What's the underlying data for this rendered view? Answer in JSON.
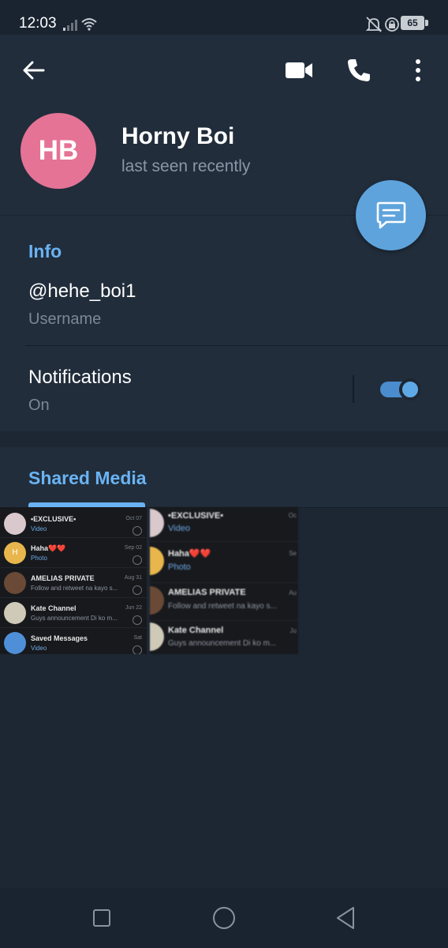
{
  "status_bar": {
    "time": "12:03",
    "battery": "65"
  },
  "header": {
    "avatar_initials": "HB",
    "name": "Horny Boi",
    "last_seen": "last seen recently",
    "icons": [
      "back-arrow-icon",
      "video-call-icon",
      "phone-icon",
      "more-vertical-icon"
    ],
    "fab_icon": "message-icon"
  },
  "info": {
    "title": "Info",
    "username": "@hehe_boi1",
    "username_label": "Username",
    "notifications_label": "Notifications",
    "notifications_value": "On",
    "notifications_enabled": true
  },
  "shared_media": {
    "title": "Shared Media",
    "thumb1": {
      "rows": [
        {
          "name": "•EXCLUSIVE•",
          "sub": "Video",
          "date": "Oct 07",
          "avatar_color": "#d9c8cc"
        },
        {
          "name": "Haha❤️❤️",
          "sub": "Photo",
          "date": "Sep 02",
          "avatar_color": "#e8b64c",
          "initial": "H"
        },
        {
          "name": "AMELIAS PRIVATE",
          "sub": "Follow and retweet na kayo s...",
          "date": "Aug 31",
          "avatar_color": "#6a4a36"
        },
        {
          "name": "Kate Channel",
          "sub": "Guys announcement Di ko m...",
          "date": "Jun 22",
          "avatar_color": "#cfc9b8"
        },
        {
          "name": "Saved Messages",
          "sub": "Video",
          "date": "Sat",
          "avatar_color": "#4f8fd8"
        }
      ]
    },
    "thumb2": {
      "rows": [
        {
          "name": "•EXCLUSIVE•",
          "sub": "Video",
          "date": "Oc"
        },
        {
          "name": "Haha❤️❤️",
          "sub": "Photo",
          "date": "Se"
        },
        {
          "name": "AMELIAS PRIVATE",
          "sub": "Follow and retweet na kayo s...",
          "date": "Au"
        },
        {
          "name": "Kate Channel",
          "sub": "Guys announcement Di ko m...",
          "date": "Ju"
        }
      ]
    }
  },
  "nav_bar": {
    "icons": [
      "recents-square-icon",
      "home-circle-icon",
      "back-triangle-icon"
    ]
  },
  "colors": {
    "accent": "#6ab3f3",
    "background": "#1d2733",
    "card": "#212d3b",
    "avatar": "#e57395",
    "fab": "#5ea3dc"
  }
}
